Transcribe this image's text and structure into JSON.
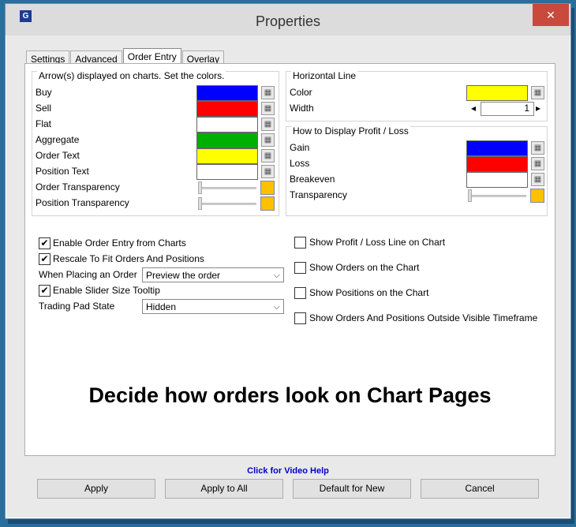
{
  "window": {
    "title": "Properties",
    "close": "✕",
    "icon_letter": "G"
  },
  "tabs": [
    {
      "label": "Settings"
    },
    {
      "label": "Advanced"
    },
    {
      "label": "Order Entry"
    },
    {
      "label": "Overlay"
    }
  ],
  "arrows": {
    "title": "Arrow(s) displayed on charts. Set the colors.",
    "rows": [
      {
        "label": "Buy",
        "color": "#0000ff"
      },
      {
        "label": "Sell",
        "color": "#ff0000"
      },
      {
        "label": "Flat",
        "color": "#ffffff"
      },
      {
        "label": "Aggregate",
        "color": "#00b000"
      },
      {
        "label": "Order Text",
        "color": "#ffff00"
      },
      {
        "label": "Position Text",
        "color": "#ffffff"
      }
    ],
    "order_transparency": "Order Transparency",
    "position_transparency": "Position Transparency"
  },
  "horizontal_line": {
    "title": "Horizontal Line",
    "color_label": "Color",
    "color": "#ffff00",
    "width_label": "Width",
    "width_value": "1"
  },
  "profit_loss": {
    "title": "How to Display Profit / Loss",
    "rows": [
      {
        "label": "Gain",
        "color": "#0000ff"
      },
      {
        "label": "Loss",
        "color": "#ff0000"
      },
      {
        "label": "Breakeven",
        "color": "#ffffff"
      }
    ],
    "transparency": "Transparency"
  },
  "options_left": {
    "enable_order_entry": {
      "label": "Enable Order Entry from Charts",
      "checked": true
    },
    "rescale": {
      "label": "Rescale To Fit Orders And Positions",
      "checked": true
    },
    "when_placing_label": "When Placing an Order",
    "when_placing_value": "Preview the order",
    "slider_tooltip": {
      "label": "Enable Slider Size Tooltip",
      "checked": true
    },
    "trading_pad_label": "Trading Pad State",
    "trading_pad_value": "Hidden"
  },
  "options_right": [
    {
      "label": "Show Profit / Loss Line on Chart",
      "checked": false
    },
    {
      "label": "Show Orders on the Chart",
      "checked": false
    },
    {
      "label": "Show Positions on the Chart",
      "checked": false
    },
    {
      "label": "Show Orders And Positions Outside Visible Timeframe",
      "checked": false
    }
  ],
  "promo_text": "Decide how orders look on Chart Pages",
  "video_help": "Click for Video Help",
  "buttons": {
    "apply": "Apply",
    "apply_all": "Apply to All",
    "default_new": "Default for New",
    "cancel": "Cancel"
  },
  "icons": {
    "picker": "color-picker-icon",
    "check": "✔",
    "chevron": "⌵",
    "spin_left": "◂",
    "spin_right": "▸"
  }
}
